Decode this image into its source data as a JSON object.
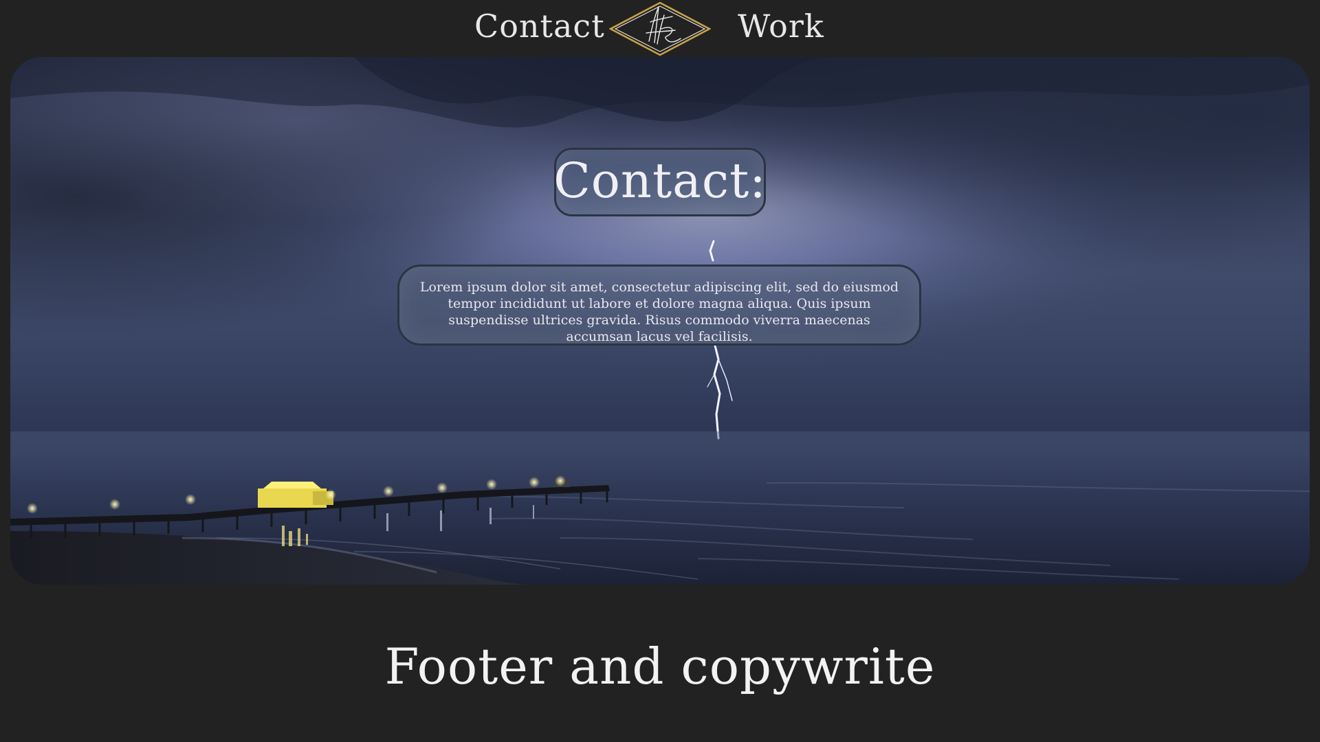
{
  "nav": {
    "left_label": "Contact",
    "right_label": "Work",
    "logo_icon": "signature-diamond-logo-icon"
  },
  "hero": {
    "title": "Contact:",
    "body": "Lorem ipsum dolor sit amet, consectetur adipiscing elit, sed do eiusmod tempor incididunt ut labore et dolore magna aliqua. Quis ipsum suspendisse ultrices gravida. Risus commodo viverra maecenas accumsan lacus vel facilisis.",
    "image_icon": "stormy-sea-pier-lightning-photo"
  },
  "footer": {
    "text": "Footer and copywrite"
  },
  "colors": {
    "page_background": "#222222",
    "text": "#f0f0f0",
    "logo_gold": "#c9a24a",
    "panel_border": "#2b3442"
  }
}
